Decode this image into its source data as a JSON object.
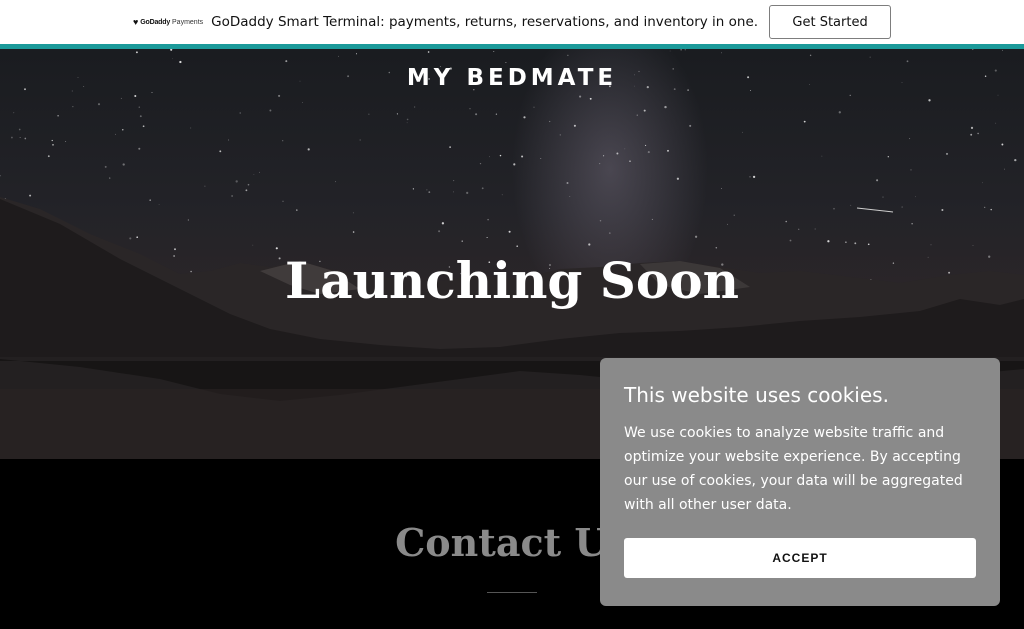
{
  "promo": {
    "logo_name": "GoDaddy",
    "logo_sub": "Payments",
    "text": "GoDaddy Smart Terminal: payments, returns, reservations, and inventory in one.",
    "cta_label": "Get Started"
  },
  "hero": {
    "site_title": "MY BEDMATE",
    "heading": "Launching Soon"
  },
  "contact": {
    "title": "Contact Us"
  },
  "cookie_banner": {
    "title": "This website uses cookies.",
    "body": "We use cookies to analyze website traffic and optimize your website experience. By accepting our use of cookies, your data will be aggregated with all other user data.",
    "accept_label": "ACCEPT"
  },
  "colors": {
    "accent_rule": "#1b9a9a",
    "cookie_background": "#8a8a8a",
    "page_background": "#000000"
  },
  "icons": {
    "promo_logo": "godaddy-logo-icon"
  }
}
